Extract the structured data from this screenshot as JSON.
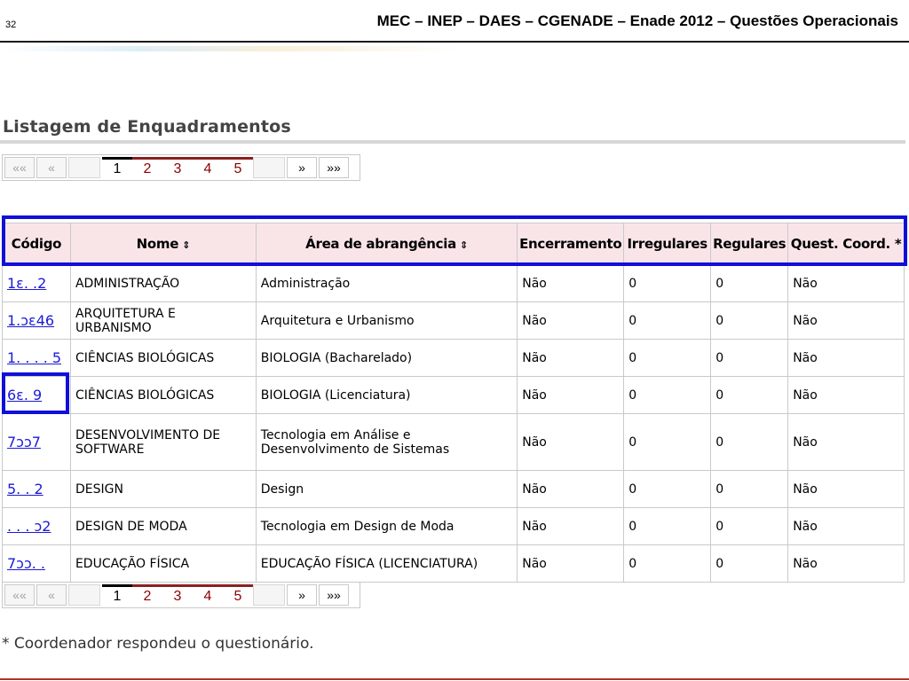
{
  "slide": {
    "number": "32",
    "title": "MEC – INEP – DAES – CGENADE – Enade 2012 – Questões Operacionais"
  },
  "page_title": "Listagem de Enquadramentos",
  "pagination": {
    "first": "««",
    "prev": "«",
    "pages": [
      "1",
      "2",
      "3",
      "4",
      "5"
    ],
    "current": "1",
    "next": "»",
    "last": "»»"
  },
  "table": {
    "headers": {
      "codigo": "Código",
      "nome": "Nome",
      "area": "Área de abrangência",
      "encerramento": "Encerramento",
      "irregulares": "Irregulares",
      "regulares": "Regulares",
      "quest": "Quest. Coord. *"
    },
    "sort_icon": "⇕",
    "rows": [
      {
        "codigo": "1ɛ. .2",
        "nome": "ADMINISTRAÇÃO",
        "area": "Administração",
        "encerramento": "Não",
        "irregulares": "0",
        "regulares": "0",
        "quest": "Não"
      },
      {
        "codigo": "1.ɔɛ46",
        "nome": "ARQUITETURA E URBANISMO",
        "area": "Arquitetura e Urbanismo",
        "encerramento": "Não",
        "irregulares": "0",
        "regulares": "0",
        "quest": "Não"
      },
      {
        "codigo": "1. . . . 5",
        "nome": "CIÊNCIAS BIOLÓGICAS",
        "area": "BIOLOGIA (Bacharelado)",
        "encerramento": "Não",
        "irregulares": "0",
        "regulares": "0",
        "quest": "Não"
      },
      {
        "codigo": "6ɛ. 9",
        "nome": "CIÊNCIAS BIOLÓGICAS",
        "area": "BIOLOGIA (Licenciatura)",
        "encerramento": "Não",
        "irregulares": "0",
        "regulares": "0",
        "quest": "Não"
      },
      {
        "codigo": "7ɔɔ7",
        "nome": "DESENVOLVIMENTO DE SOFTWARE",
        "area": "Tecnologia em Análise e Desenvolvimento de Sistemas",
        "encerramento": "Não",
        "irregulares": "0",
        "regulares": "0",
        "quest": "Não",
        "tall": true
      },
      {
        "codigo": "5. . 2",
        "nome": "DESIGN",
        "area": "Design",
        "encerramento": "Não",
        "irregulares": "0",
        "regulares": "0",
        "quest": "Não"
      },
      {
        "codigo": ". . . ɔ2",
        "nome": "DESIGN DE MODA",
        "area": "Tecnologia em Design de Moda",
        "encerramento": "Não",
        "irregulares": "0",
        "regulares": "0",
        "quest": "Não"
      },
      {
        "codigo": "7ɔɔ. .",
        "nome": "EDUCAÇÃO FÍSICA",
        "area": "EDUCAÇÃO FÍSICA (LICENCIATURA)",
        "encerramento": "Não",
        "irregulares": "0",
        "regulares": "0",
        "quest": "Não"
      }
    ]
  },
  "footnote": "* Coordenador respondeu o questionário.",
  "colors": {
    "header_bg": "#f9e5e8",
    "highlight": "#1010d8",
    "link": "#1b1bd6",
    "page_link": "#8b0000"
  }
}
